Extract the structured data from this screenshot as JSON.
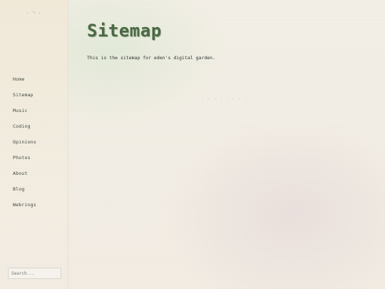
{
  "sidebar": {
    "items": [
      {
        "label": "Home"
      },
      {
        "label": "Sitemap"
      },
      {
        "label": "Music"
      },
      {
        "label": "Coding"
      },
      {
        "label": "Opinions"
      },
      {
        "label": "Photos"
      },
      {
        "label": "About"
      },
      {
        "label": "Blog"
      },
      {
        "label": "Webrings"
      }
    ],
    "search": {
      "placeholder": "Search...",
      "value": ""
    }
  },
  "main": {
    "title": "Sitemap",
    "intro": "This is the sitemap for eden's digital garden."
  },
  "colors": {
    "title": "#4a6a44",
    "background": "#f3efe6",
    "sidebar": "#f1ead9"
  }
}
